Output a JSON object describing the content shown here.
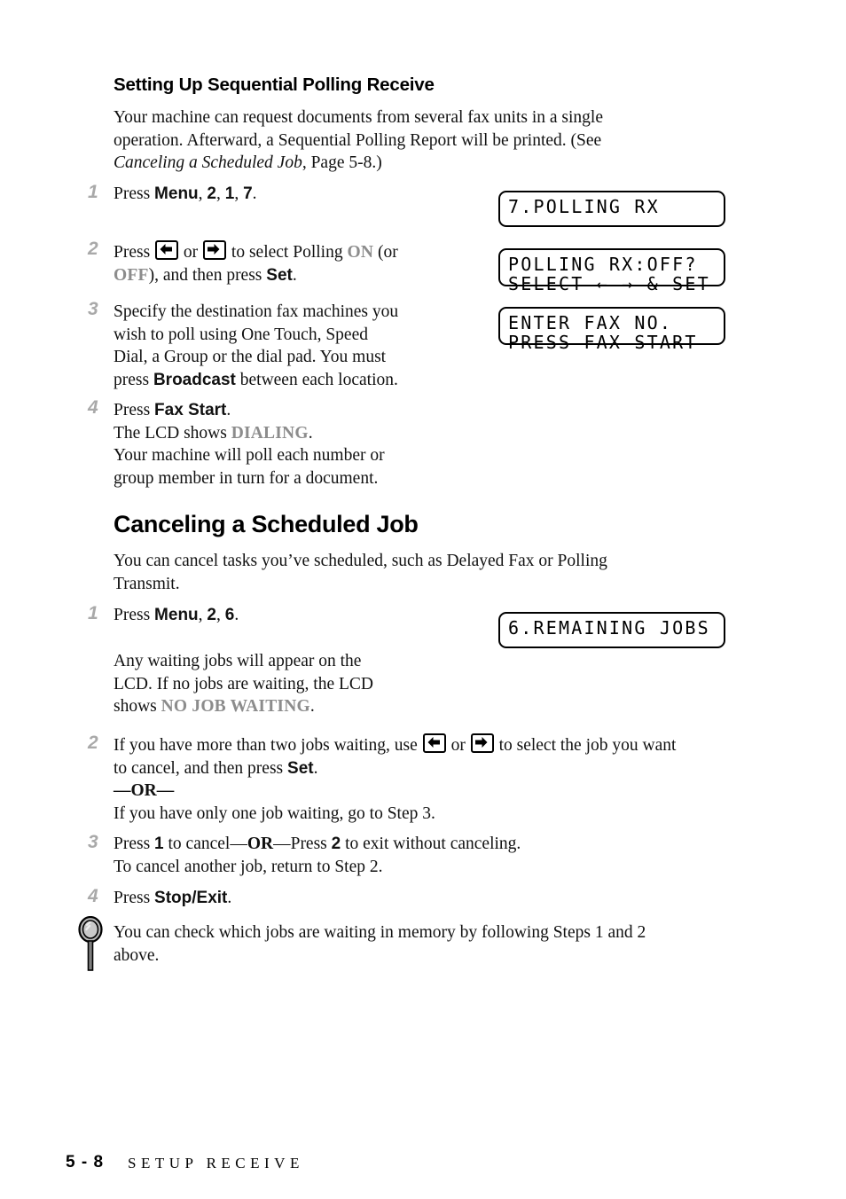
{
  "document": {
    "section_heading": "Setting Up Sequential Polling Receive",
    "main_heading": "Canceling a Scheduled Job"
  },
  "polling": {
    "intro_line1": "Your machine can request documents from several fax units in a single",
    "intro_line2": "operation. Afterward, a Sequential Polling Report will be printed. (See",
    "intro_ref_italic": "Canceling a Scheduled Job",
    "intro_line3_tail": ", Page 5-8.)",
    "steps": [
      {
        "number": "1",
        "pre": "Press ",
        "key1": "Menu",
        "sep1": ", ",
        "key2": "2",
        "sep2": ", ",
        "key3": "1",
        "sep3": ", ",
        "key4": "7",
        "end": "."
      },
      {
        "number": "2",
        "l1a": "Press ",
        "l1b": " or ",
        "l1c": " to select Polling ",
        "l1_on": "ON",
        "l1d": " (or",
        "l2_off": "OFF",
        "l2a": "), and then press ",
        "l2_set": "Set",
        "l2b": "."
      },
      {
        "number": "3",
        "l1": "Specify the destination fax machines you",
        "l2": "wish to poll using One Touch, Speed",
        "l3": "Dial, a Group or the dial pad. You must",
        "l4a": "press ",
        "l4_key": "Broadcast",
        "l4b": " between each location."
      },
      {
        "number": "4",
        "l1a": "Press ",
        "l1_key": "Fax Start",
        "l1b": ".",
        "l2a": "The LCD shows ",
        "l2_lcd": "DIALING",
        "l2b": ".",
        "l3": "Your machine will poll each number or",
        "l4": "group member in turn for a document."
      }
    ],
    "lcd_panels": [
      {
        "name": "polling-rx",
        "lines": [
          "7.POLLING RX",
          ""
        ]
      },
      {
        "name": "polling-rx-off",
        "lines": [
          "POLLING RX:OFF?",
          "SELECT ← → & SET"
        ]
      },
      {
        "name": "enter-fax-no",
        "lines": [
          "ENTER FAX NO.",
          "PRESS FAX START"
        ]
      }
    ]
  },
  "canceling": {
    "intro_line1": "You can cancel tasks you’ve scheduled, such as Delayed Fax or Polling",
    "intro_line2": "Transmit.",
    "steps": [
      {
        "number": "1",
        "pre": "Press ",
        "key1": "Menu",
        "sep1": ", ",
        "key2": "2",
        "sep2": ", ",
        "key3": "6",
        "end": "."
      },
      {
        "number": "2",
        "l1a": "If you have more than two jobs waiting, use ",
        "l1b": " or ",
        "l1c": " to select the job you want",
        "l2a": "to cancel, and then press ",
        "l2_set": "Set",
        "l2b": ".",
        "l3_or": "—OR—",
        "l4": "If you have only one job waiting, go to Step 3."
      },
      {
        "number": "3",
        "l1a": "Press ",
        "l1_k1": "1",
        "l1b": " to cancel—",
        "l1_or": "OR",
        "l1c": "—Press ",
        "l1_k2": "2",
        "l1d": " to exit without canceling.",
        "l2": "To cancel another job, return to Step 2."
      },
      {
        "number": "4",
        "l1a": "Press ",
        "l1_key": "Stop/Exit",
        "l1b": "."
      }
    ],
    "note_line1": "Any waiting jobs will appear on the",
    "note_line2": "LCD. If no jobs are waiting, the LCD",
    "note_line3a": "shows ",
    "note_line3_lcd": "NO JOB WAITING",
    "note_line3b": ".",
    "lcd_panels": [
      {
        "name": "remaining-jobs",
        "lines": [
          "6.REMAINING JOBS",
          ""
        ]
      }
    ]
  },
  "tip": {
    "icon": "magnifying-glass-icon",
    "line1": "You can check which jobs are waiting in memory by following Steps 1 and 2",
    "line2": "above."
  },
  "footer": {
    "page_number": "5 - 8",
    "section_name": "SETUP RECEIVE"
  },
  "colors": {
    "step_number_gray": "#a9a9a9",
    "lcd_term_gray": "#8c8c8c",
    "text_black": "#111111",
    "tip_lens_gray": "#b9b9b9"
  }
}
